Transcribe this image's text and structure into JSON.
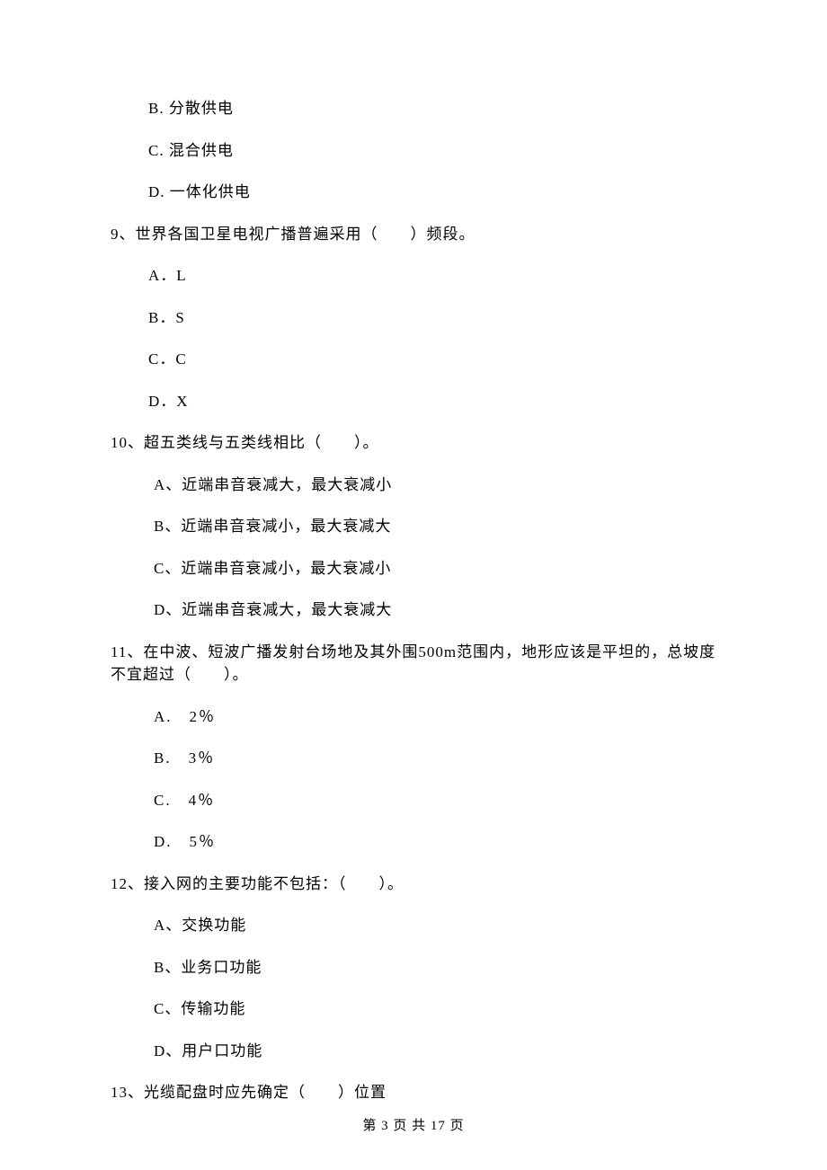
{
  "q8": {
    "optB": "B. 分散供电",
    "optC": "C. 混合供电",
    "optD": "D. 一体化供电"
  },
  "q9": {
    "stem": "9、世界各国卫星电视广播普遍采用（　　）频段。",
    "optA": "A．L",
    "optB": "B．S",
    "optC": "C．C",
    "optD": "D．X"
  },
  "q10": {
    "stem": "10、超五类线与五类线相比（　　）。",
    "optA": "A、近端串音衰减大，最大衰减小",
    "optB": "B、近端串音衰减小，最大衰减大",
    "optC": "C、近端串音衰减小，最大衰减小",
    "optD": "D、近端串音衰减大，最大衰减大"
  },
  "q11": {
    "stem": "11、在中波、短波广播发射台场地及其外围500m范围内，地形应该是平坦的，总坡度不宜超过（　　）。",
    "optA": "A.　2％",
    "optB": "B.　3％",
    "optC": "C.　4％",
    "optD": "D.　5％"
  },
  "q12": {
    "stem": "12、接入网的主要功能不包括：（　　）。",
    "optA": "A、交换功能",
    "optB": "B、业务口功能",
    "optC": "C、传输功能",
    "optD": "D、用户口功能"
  },
  "q13": {
    "stem": "13、光缆配盘时应先确定（　　）位置"
  },
  "footer": "第 3 页 共 17 页"
}
